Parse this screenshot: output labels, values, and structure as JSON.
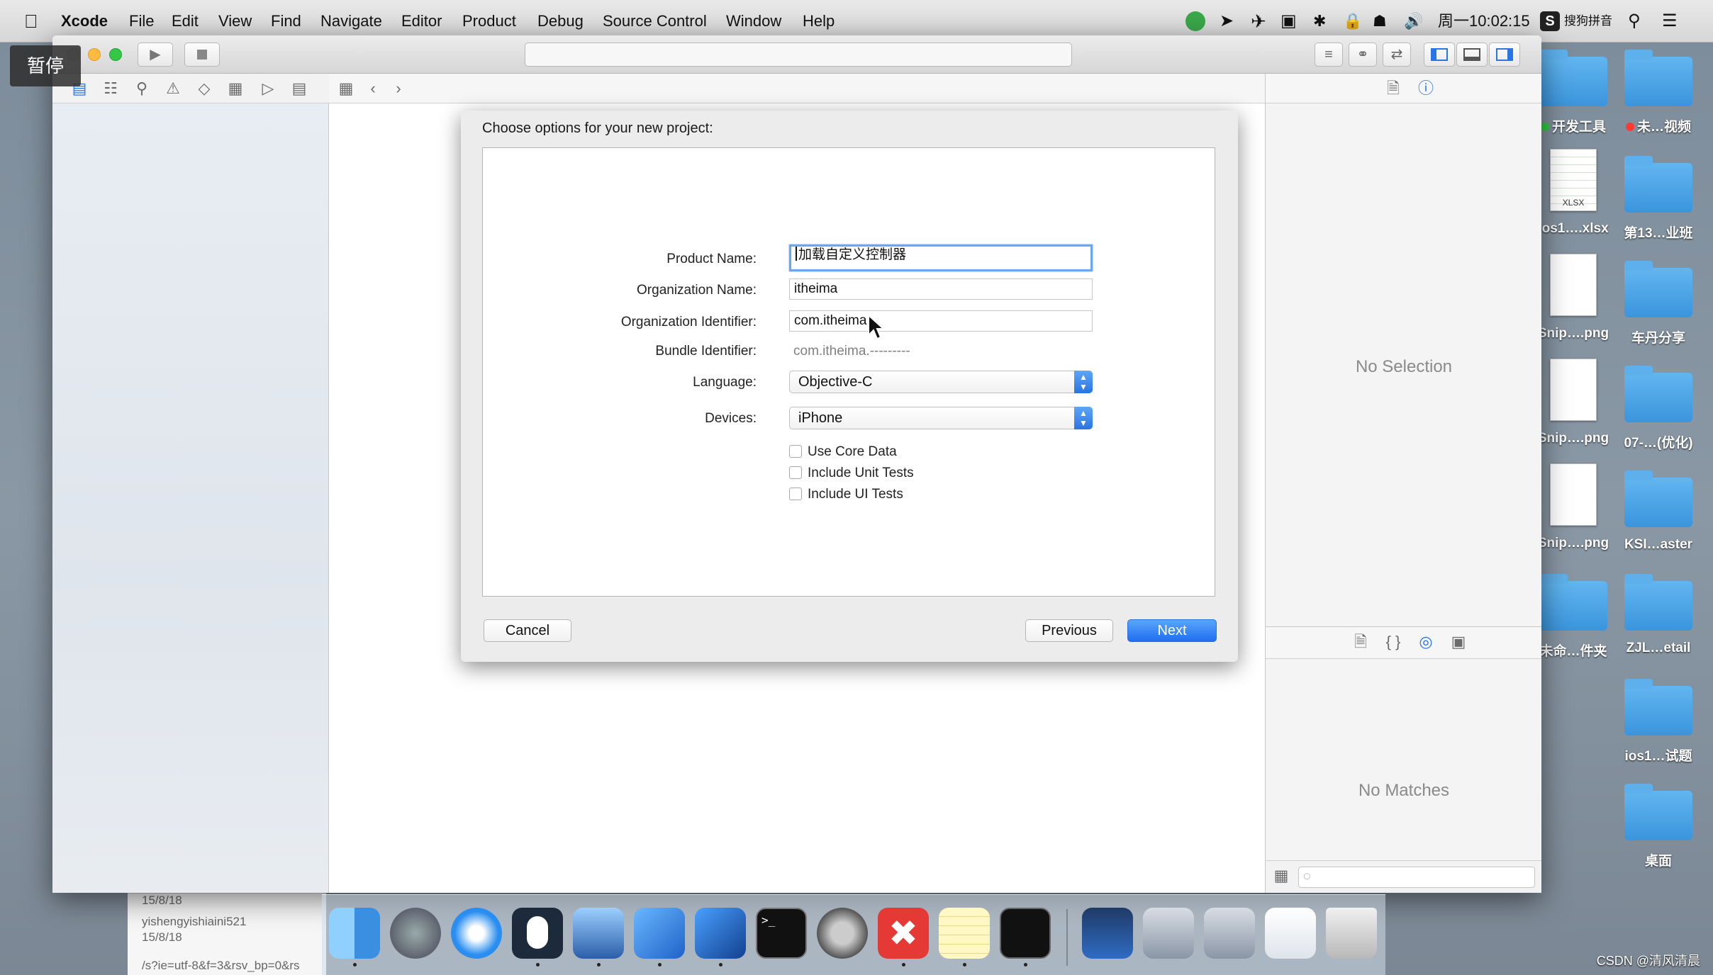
{
  "menubar": {
    "items": [
      "Xcode",
      "File",
      "Edit",
      "View",
      "Find",
      "Navigate",
      "Editor",
      "Product",
      "Debug",
      "Source Control",
      "Window",
      "Help"
    ],
    "clock": "周一10:02:15",
    "input_method": "搜狗拼音"
  },
  "overlay": {
    "pause_label": "暂停"
  },
  "dialog": {
    "title": "Choose options for your new project:",
    "fields": {
      "product_name_label": "Product Name:",
      "product_name_value": "加载自定义控制器",
      "organization_name_label": "Organization Name:",
      "organization_name_value": "itheima",
      "organization_identifier_label": "Organization Identifier:",
      "organization_identifier_value": "com.itheima",
      "bundle_identifier_label": "Bundle Identifier:",
      "bundle_identifier_value": "com.itheima.---------",
      "language_label": "Language:",
      "language_value": "Objective-C",
      "devices_label": "Devices:",
      "devices_value": "iPhone"
    },
    "checkboxes": [
      {
        "label": "Use Core Data",
        "checked": false
      },
      {
        "label": "Include Unit Tests",
        "checked": false
      },
      {
        "label": "Include UI Tests",
        "checked": false
      }
    ],
    "buttons": {
      "cancel": "Cancel",
      "previous": "Previous",
      "next": "Next"
    }
  },
  "inspector": {
    "no_selection": "No Selection",
    "no_matches": "No Matches"
  },
  "desktop": {
    "icons": [
      {
        "label": "开发工具",
        "kind": "folder",
        "dot": "#2ecc40"
      },
      {
        "label": "未…视频",
        "kind": "folder",
        "dot": "#ff3b30"
      },
      {
        "label": "ios1….xlsx",
        "kind": "file",
        "tag": "XLSX"
      },
      {
        "label": "第13…业班",
        "kind": "folder"
      },
      {
        "label": "Snip….png",
        "kind": "file"
      },
      {
        "label": "车丹分享",
        "kind": "folder"
      },
      {
        "label": "Snip….png",
        "kind": "file"
      },
      {
        "label": "07-…(优化)",
        "kind": "folder"
      },
      {
        "label": "Snip….png",
        "kind": "file"
      },
      {
        "label": "KSI…aster",
        "kind": "folder"
      },
      {
        "label": "未命…件夹",
        "kind": "folder"
      },
      {
        "label": "ZJL…etail",
        "kind": "folder"
      },
      {
        "label": "ios1…试题",
        "kind": "folder"
      },
      {
        "label": "桌面",
        "kind": "folder"
      }
    ]
  },
  "background_window": {
    "line1": "15/8/18",
    "line2": "yishengyishiaini521",
    "line3": "15/8/18",
    "line4": "/s?ie=utf-8&f=3&rsv_bp=0&rs"
  },
  "watermark": "CSDN @清风清晨",
  "colors": {
    "accent": "#1f6ef0",
    "focus_ring": "#6aa6f2",
    "folder": "#3b95dc"
  }
}
